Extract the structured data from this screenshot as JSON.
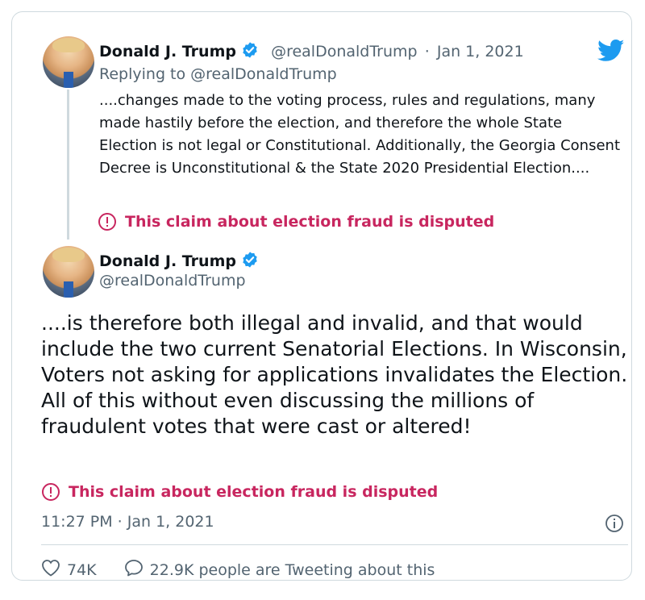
{
  "tweet1": {
    "author_name": "Donald J. Trump",
    "handle": "@realDonaldTrump",
    "separator": "·",
    "date": "Jan 1, 2021",
    "replying_to": "Replying to @realDonaldTrump",
    "text": "....changes made to the voting process, rules and regulations, many made hastily before the election, and therefore the whole State Election is not legal or Constitutional. Additionally, the Georgia Consent Decree is Unconstitutional & the State 2020 Presidential Election....",
    "dispute_label": "This claim about election fraud is disputed"
  },
  "tweet2": {
    "author_name": "Donald J. Trump",
    "handle": "@realDonaldTrump",
    "text": "....is therefore both illegal and invalid, and that would include the two current Senatorial Elections. In Wisconsin, Voters not asking for applications invalidates the Election. All of this without even discussing the millions of fraudulent votes that were cast or altered!",
    "dispute_label": "This claim about election fraud is disputed",
    "timestamp": "11:27 PM · Jan 1, 2021",
    "likes": "74K",
    "conversation": "22.9K people are Tweeting about this"
  },
  "icons": {
    "verified": "verified-badge-icon",
    "twitter": "twitter-bird-icon",
    "warning": "exclamation-circle-icon",
    "info": "info-icon",
    "like": "heart-icon",
    "reply": "speech-bubble-icon"
  },
  "colors": {
    "twitter_blue": "#1d9bf0",
    "dispute_red": "#c8265f",
    "secondary_text": "#536471",
    "border": "#cfd9de"
  }
}
